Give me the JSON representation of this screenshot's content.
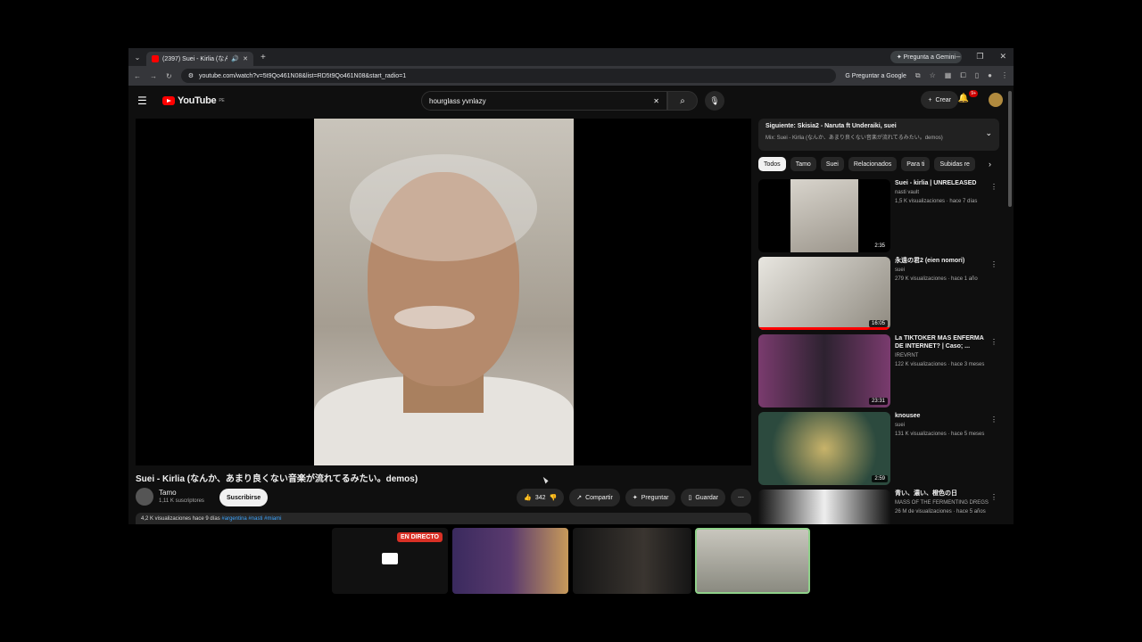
{
  "browser": {
    "tab_title": "(2397) Suei - Kirlia (なんか、あ",
    "gemini_button": "Pregunta a Gemini",
    "url": "youtube.com/watch?v=5t9Qo461N08&list=RD5t9Qo461N08&start_radio=1",
    "ask_google": "Preguntar a Google"
  },
  "youtube": {
    "logo_text": "YouTube",
    "logo_region": "PE",
    "search_value": "hourglass yvnlazy",
    "create_label": "Crear",
    "notif_count": "9+"
  },
  "video": {
    "title": "Suei - Kirlia (なんか、あまり良くない音楽が流れてるみたい。demos)",
    "channel": "Tamo",
    "subscribers": "1,11 K suscriptores",
    "subscribe_label": "Suscribirse",
    "likes": "342",
    "share_label": "Compartir",
    "ask_label": "Preguntar",
    "save_label": "Guardar",
    "desc_meta": "4,2 K visualizaciones  hace 9 días",
    "desc_tags": "#argentina #nasti #miami"
  },
  "sidebar": {
    "next_title": "Siguiente: Skisia2 - Naruta ft Underaiki, suei",
    "next_sub": "Mix: Suei - Kirlia (なんか、あまり良くない音楽が流れてるみたい。demos)",
    "chips": [
      "Todos",
      "Tamo",
      "Suei",
      "Relacionados",
      "Para ti",
      "Subidas re"
    ],
    "recs": [
      {
        "title": "Suei - kirlia | UNRELEASED",
        "channel": "nasti vault",
        "meta": "1,5 K visualizaciones · hace 7 días",
        "duration": "2:35"
      },
      {
        "title": "永遠の君2 (eien nomori)",
        "channel": "suei",
        "meta": "279 K visualizaciones · hace 1 año",
        "duration": "16:05"
      },
      {
        "title": "La TIKTOKER MAS ENFERMA DE INTERNET? | Caso; ...",
        "channel": "IREVRNT",
        "meta": "122 K visualizaciones · hace 3 meses",
        "duration": "23:31"
      },
      {
        "title": "knousee",
        "channel": "suei",
        "meta": "131 K visualizaciones · hace 5 meses",
        "duration": "2:59"
      },
      {
        "title": "青い、濃い、橙色の日",
        "channel": "MASS OF THE FERMENTING DREGS",
        "meta": "26 M de visualizaciones · hace 5 años",
        "duration": ""
      }
    ]
  },
  "meet": {
    "live_label": "EN DIRECTO"
  },
  "colors": {
    "yt_red": "#ff0000",
    "bg": "#0f0f0f",
    "live_red": "#d93025"
  }
}
